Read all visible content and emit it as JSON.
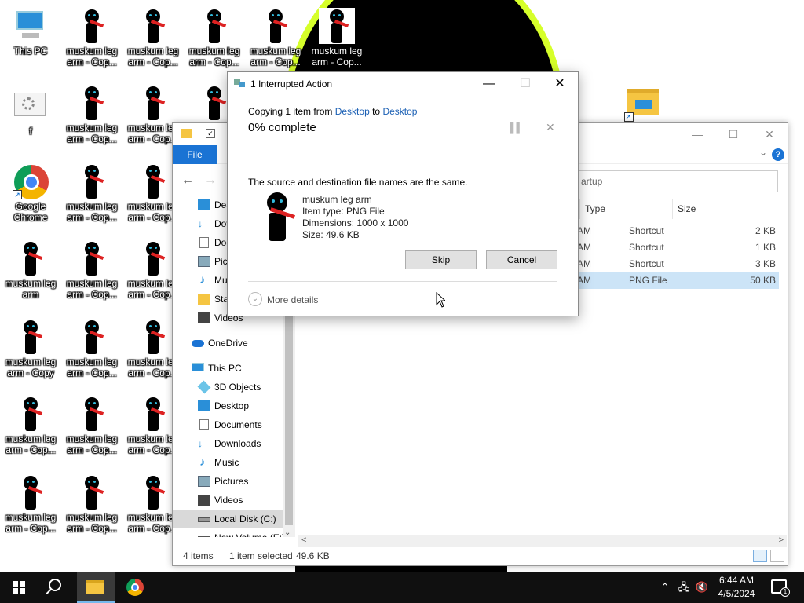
{
  "desktop": {
    "icons": [
      {
        "label": "This PC"
      },
      {
        "label": "muskum leg arm - Cop..."
      },
      {
        "label": "muskum leg arm - Cop..."
      },
      {
        "label": "muskum leg arm - Cop..."
      },
      {
        "label": "muskum leg arm - Cop..."
      },
      {
        "label": "muskum leg arm - Cop..."
      },
      {
        "label": "f"
      },
      {
        "label": "muskum leg arm - Cop..."
      },
      {
        "label": "muskum leg arm - Cop..."
      },
      {
        "label": "Google Chrome"
      },
      {
        "label": "muskum leg arm - Cop..."
      },
      {
        "label": "muskum leg arm - Cop..."
      },
      {
        "label": "muskum leg arm"
      },
      {
        "label": "muskum leg arm - Cop..."
      },
      {
        "label": "muskum leg arm - Cop..."
      },
      {
        "label": "muskum leg arm - Copy"
      },
      {
        "label": "muskum leg arm - Cop..."
      },
      {
        "label": "muskum leg arm - Cop..."
      },
      {
        "label": "muskum leg arm - Cop..."
      },
      {
        "label": "muskum leg arm - Cop..."
      },
      {
        "label": "muskum leg arm - Cop..."
      },
      {
        "label": "muskum leg arm - Cop..."
      },
      {
        "label": "muskum leg arm - Cop..."
      },
      {
        "label": "muskum leg arm - Cop..."
      }
    ]
  },
  "explorer": {
    "file_tab": "File",
    "help": "?",
    "search_placeholder": "...artup",
    "search_value": "artup",
    "nav": [
      {
        "label": "Des",
        "icon": "desktop-icon"
      },
      {
        "label": "Dov",
        "icon": "downloads-icon"
      },
      {
        "label": "Doc",
        "icon": "documents-icon"
      },
      {
        "label": "Pict",
        "icon": "pictures-icon"
      },
      {
        "label": "Mu",
        "icon": "music-icon"
      },
      {
        "label": "Sta",
        "icon": "folder-icon"
      },
      {
        "label": "Videos",
        "icon": "videos-icon"
      },
      {
        "label": "OneDrive",
        "icon": "onedrive-icon"
      },
      {
        "label": "This PC",
        "icon": "computer-icon"
      },
      {
        "label": "3D Objects",
        "icon": "3d-objects-icon"
      },
      {
        "label": "Desktop",
        "icon": "desktop-icon"
      },
      {
        "label": "Documents",
        "icon": "documents-icon"
      },
      {
        "label": "Downloads",
        "icon": "downloads-icon"
      },
      {
        "label": "Music",
        "icon": "music-icon"
      },
      {
        "label": "Pictures",
        "icon": "pictures-icon"
      },
      {
        "label": "Videos",
        "icon": "videos-icon"
      },
      {
        "label": "Local Disk (C:)",
        "icon": "drive-icon"
      },
      {
        "label": "New Volume (E:)",
        "icon": "drive-icon"
      }
    ],
    "columns": {
      "type": "Type",
      "size": "Size"
    },
    "rows": [
      {
        "date_suffix": "AM",
        "type": "Shortcut",
        "size": "2 KB"
      },
      {
        "date_suffix": "AM",
        "type": "Shortcut",
        "size": "1 KB"
      },
      {
        "date_suffix": "AM",
        "type": "Shortcut",
        "size": "3 KB"
      },
      {
        "date_suffix": "AM",
        "type": "PNG File",
        "size": "50 KB"
      }
    ],
    "status": {
      "items": "4 items",
      "selected": "1 item selected",
      "size": "49.6 KB"
    }
  },
  "dialog": {
    "title": "1 Interrupted Action",
    "copying_prefix": "Copying 1 item from",
    "from": "Desktop",
    "to_word": "to",
    "to": "Desktop",
    "percent": "0% complete",
    "message": "The source and destination file names are the same.",
    "file": {
      "name": "muskum leg arm",
      "type": "Item type: PNG File",
      "dimensions": "Dimensions: 1000 x 1000",
      "size": "Size: 49.6 KB"
    },
    "skip": "Skip",
    "cancel": "Cancel",
    "more_details": "More details"
  },
  "taskbar": {
    "time": "6:44 AM",
    "date": "4/5/2024",
    "notification_count": "1"
  }
}
